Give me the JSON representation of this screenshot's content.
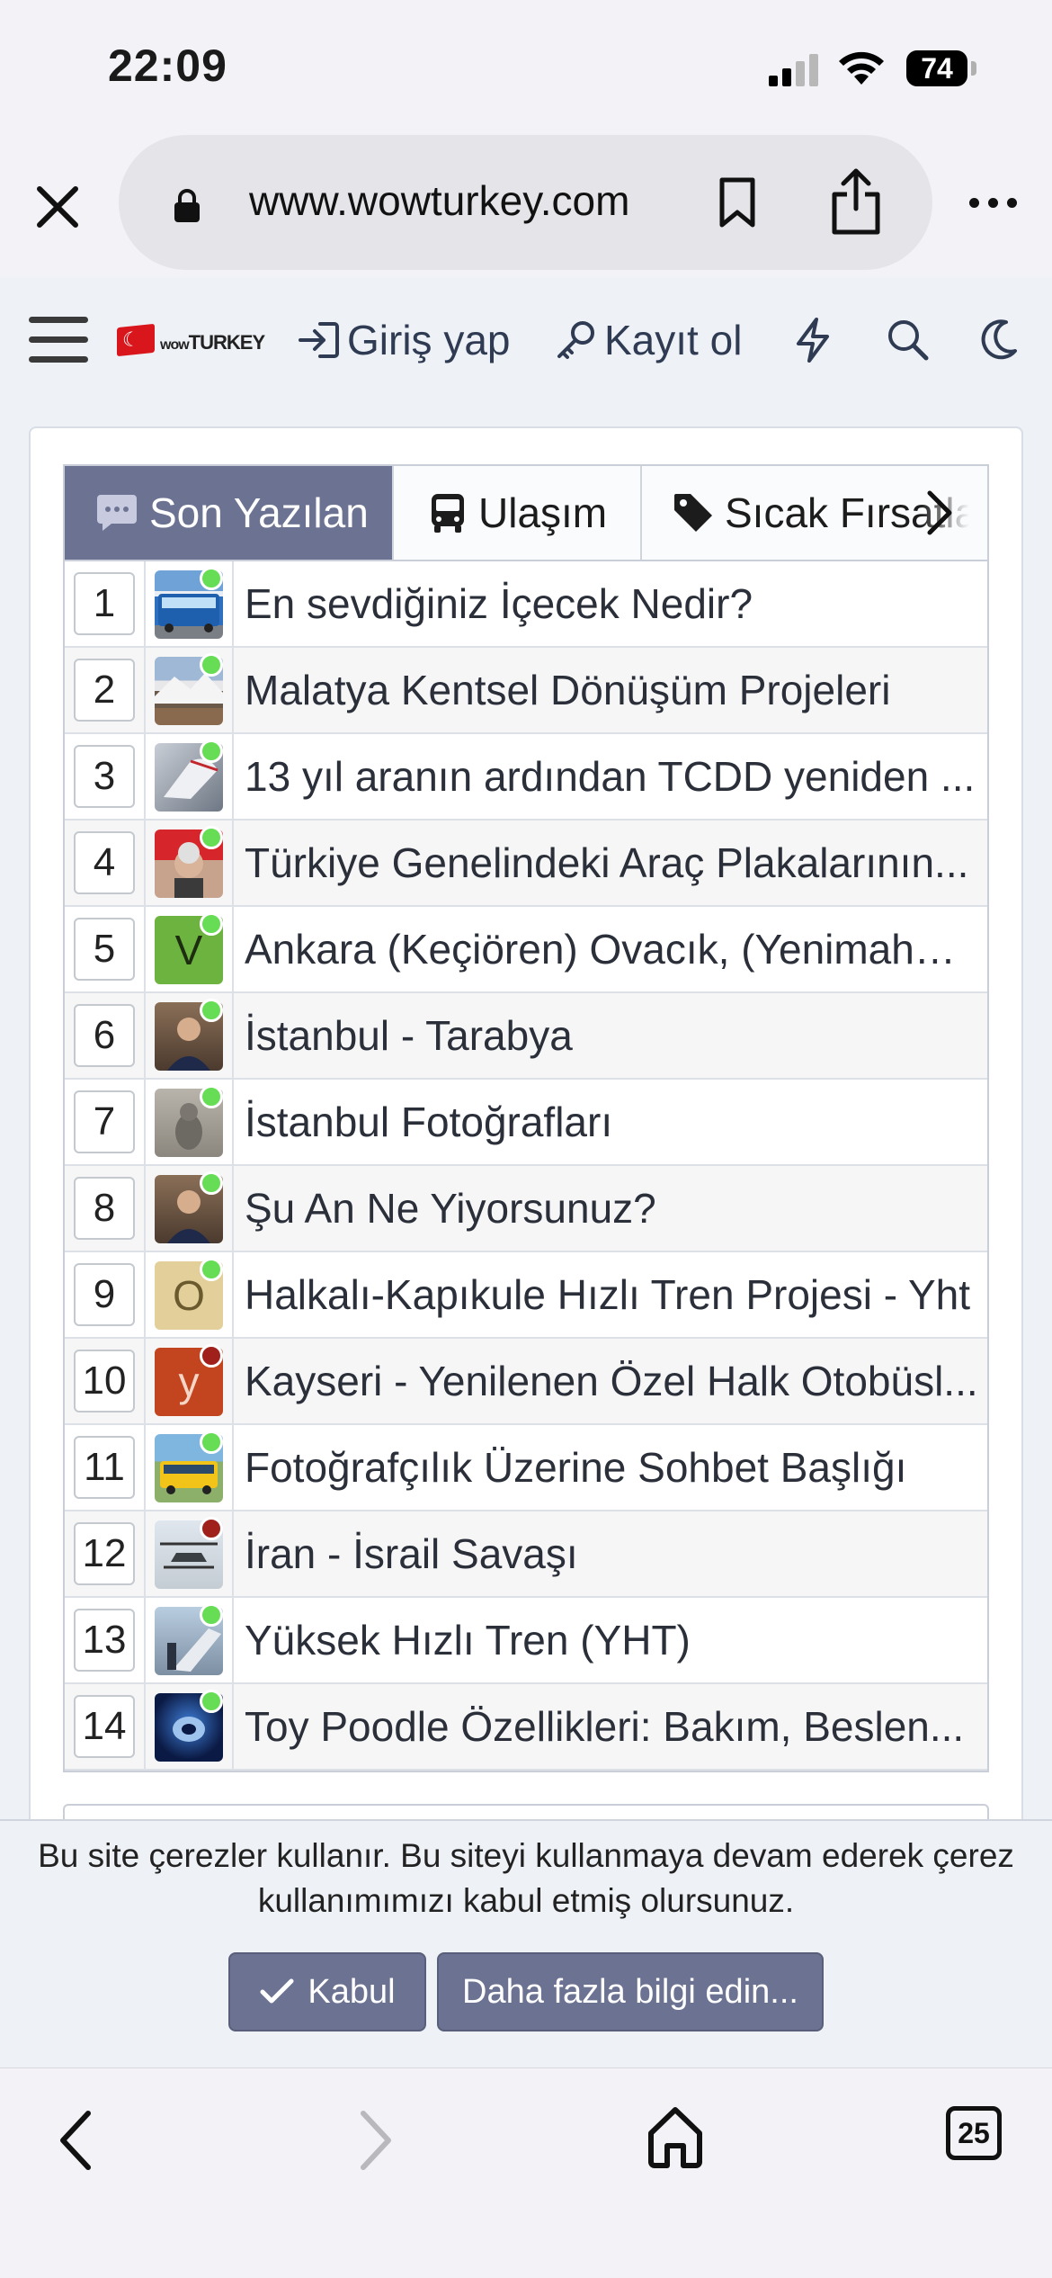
{
  "status_bar": {
    "time": "22:09",
    "battery": "74"
  },
  "browser": {
    "url": "www.wowturkey.com",
    "tabs_count": "25"
  },
  "site_nav": {
    "logo": "wowTURKEY",
    "login": "Giriş yap",
    "register": "Kayıt ol"
  },
  "tabs": [
    {
      "label": "Son Yazılan",
      "active": true
    },
    {
      "label": "Ulaşım",
      "active": false
    },
    {
      "label": "Sıcak Fırsatlar",
      "active": false
    }
  ],
  "topics": [
    {
      "num": "1",
      "title": "En sevdiğiniz İçecek Nedir?",
      "status": "online"
    },
    {
      "num": "2",
      "title": "Malatya Kentsel Dönüşüm Projeleri",
      "status": "online"
    },
    {
      "num": "3",
      "title": "13 yıl aranın ardından TCDD yeniden ...",
      "status": "online"
    },
    {
      "num": "4",
      "title": "Türkiye Genelindeki Araç Plakalarının...",
      "status": "online"
    },
    {
      "num": "5",
      "title": "Ankara (Keçiören) Ovacık, (Yenimahal...",
      "status": "online",
      "avatar_letter": "V"
    },
    {
      "num": "6",
      "title": "İstanbul - Tarabya",
      "status": "online"
    },
    {
      "num": "7",
      "title": "İstanbul Fotoğrafları",
      "status": "online"
    },
    {
      "num": "8",
      "title": "Şu An Ne Yiyorsunuz?",
      "status": "online"
    },
    {
      "num": "9",
      "title": "Halkalı-Kapıkule Hızlı Tren Projesi - Yht",
      "status": "online",
      "avatar_letter": "O"
    },
    {
      "num": "10",
      "title": "Kayseri - Yenilenen Özel Halk Otobüsl...",
      "status": "offline",
      "avatar_letter": "y"
    },
    {
      "num": "11",
      "title": "Fotoğrafçılık Üzerine Sohbet Başlığı",
      "status": "online"
    },
    {
      "num": "12",
      "title": "İran - İsrail Savaşı",
      "status": "offline"
    },
    {
      "num": "13",
      "title": "Yüksek Hızlı Tren (YHT)",
      "status": "online"
    },
    {
      "num": "14",
      "title": "Toy Poodle Özellikleri: Bakım, Beslen...",
      "status": "online"
    }
  ],
  "cookie": {
    "text": "Bu site çerezler kullanır. Bu siteyi kullanmaya devam ederek çerez kullanımımızı kabul etmiş olursunuz.",
    "accept": "Kabul",
    "more_info": "Daha fazla bilgi edin..."
  },
  "colors": {
    "accent": "#6c7392",
    "online": "#66dd55",
    "offline": "#a0201c"
  }
}
